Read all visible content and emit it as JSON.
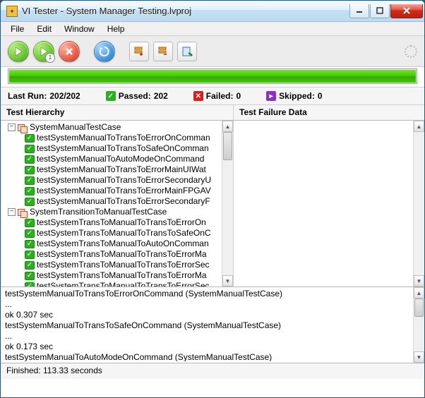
{
  "window": {
    "title": "VI Tester - System Manager Testing.lvproj",
    "appicon_text": "✦"
  },
  "menu": {
    "file": "File",
    "edit": "Edit",
    "window": "Window",
    "help": "Help"
  },
  "stats": {
    "lastrun_label": "Last Run:",
    "lastrun_value": "202/202",
    "passed_label": "Passed:",
    "passed_value": "202",
    "failed_label": "Failed:",
    "failed_value": "0",
    "skipped_label": "Skipped:",
    "skipped_value": "0"
  },
  "panes": {
    "hierarchy": "Test Hierarchy",
    "failure": "Test Failure Data"
  },
  "tree": {
    "group1": "SystemManualTestCase",
    "g1_items": [
      "testSystemManualToTransToErrorOnComman",
      "testSystemManualToTransToSafeOnComman",
      "testSystemManualToAutoModeOnCommand",
      "testSystemManualToTransToErrorMainUIWat",
      "testSystemManualToTransToErrorSecondaryU",
      "testSystemManualToTransToErrorMainFPGAV",
      "testSystemManualToTransToErrorSecondaryF"
    ],
    "group2": "SystemTransitionToManualTestCase",
    "g2_items": [
      "testSystemTransToManualToTransToErrorOn",
      "testSystemTransToManualToTransToSafeOnC",
      "testSystemTransToManualToAutoOnComman",
      "testSystemTransToManualToTransToErrorMa",
      "testSystemTransToManualToTransToErrorSec",
      "testSystemTransToManualToTransToErrorMa",
      "testSystemTransToManualToTransToErrorSec"
    ]
  },
  "log": {
    "l1": "testSystemManualToTransToErrorOnCommand (SystemManualTestCase)",
    "l2": "...",
    "l3": "ok 0.307 sec",
    "l4": "testSystemManualToTransToSafeOnCommand (SystemManualTestCase)",
    "l5": "...",
    "l6": "ok 0.173 sec",
    "l7": "testSystemManualToAutoModeOnCommand (SystemManualTestCase)"
  },
  "status": {
    "text": "Finished: 113.33 seconds"
  },
  "icons": {
    "check": "✓",
    "cross": "✕",
    "skip": "▸",
    "minus": "−",
    "up": "▲",
    "down": "▼"
  }
}
